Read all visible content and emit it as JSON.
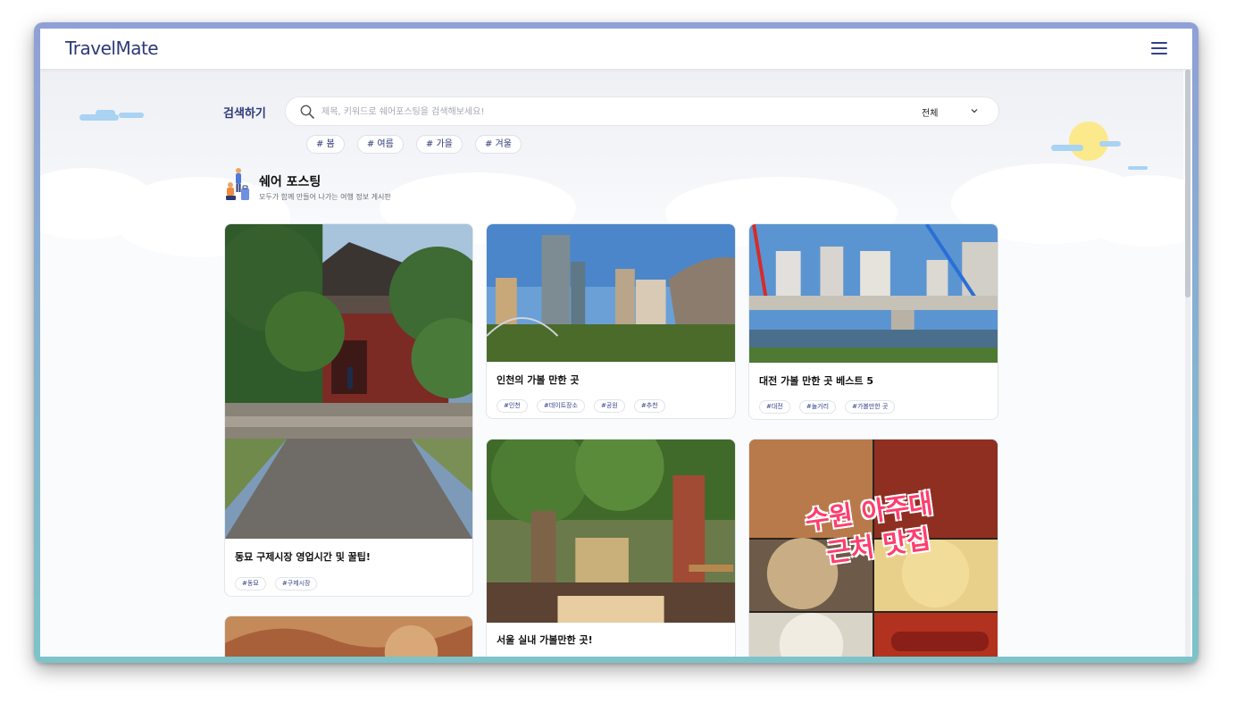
{
  "app": {
    "logo": "TravelMate"
  },
  "search": {
    "label": "검색하기",
    "placeholder": "제목, 키워드로 쉐어포스팅을 검색해보세요!",
    "filter_value": "전체"
  },
  "season_tags": [
    "# 봄",
    "# 여름",
    "# 가을",
    "# 겨울"
  ],
  "section": {
    "title": "쉐어 포스팅",
    "subtitle": "모두가 함께 만들어 나가는 여행 정보 게시판"
  },
  "posts": [
    {
      "title": "동묘 구제시장 영업시간 및 꿀팁!",
      "tags": [
        "#동묘",
        "#구제시장"
      ]
    },
    {
      "title": "인천의 가볼 만한 곳",
      "tags": [
        "#인천",
        "#데이트장소",
        "#공원",
        "#추천"
      ]
    },
    {
      "title": "대전 가볼 만한 곳 베스트 5",
      "tags": [
        "#대전",
        "#놀거리",
        "#가볼만한 곳"
      ]
    },
    {
      "title": "서울 실내 가볼만한 곳!",
      "tags": []
    },
    {
      "title": "",
      "tags": [],
      "image_text": [
        "수원 아주대",
        "근처 맛집"
      ]
    },
    {
      "title": "",
      "tags": []
    }
  ],
  "colors": {
    "brand": "#2d3a78",
    "sun": "#fbe98b",
    "cloud": "#a9d2f3"
  }
}
